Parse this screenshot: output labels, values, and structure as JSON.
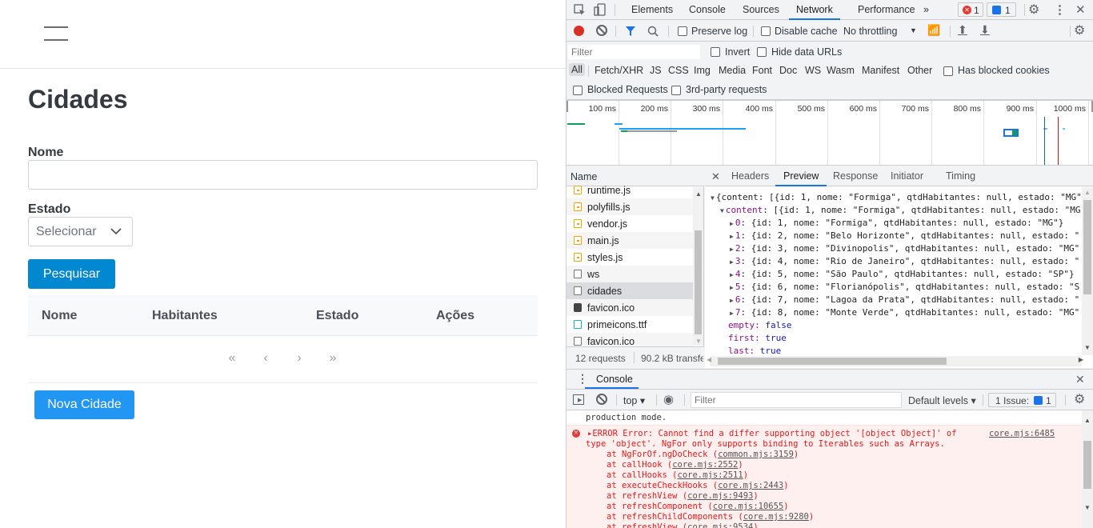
{
  "app": {
    "title": "Cidades",
    "form": {
      "nome_label": "Nome",
      "nome_value": "",
      "estado_label": "Estado",
      "estado_selected": "Selecionar",
      "search_button": "Pesquisar"
    },
    "table": {
      "columns": [
        "Nome",
        "Habitantes",
        "Estado",
        "Ações"
      ],
      "rows": []
    },
    "paginator": {
      "first": "«",
      "prev": "‹",
      "next": "›",
      "last": "»"
    },
    "new_button": "Nova Cidade"
  },
  "devtools": {
    "tabs": [
      "Elements",
      "Console",
      "Sources",
      "Network",
      "Performance",
      "»"
    ],
    "active_tab": "Network",
    "error_count": "1",
    "message_count": "1",
    "network_toolbar": {
      "preserve_log": "Preserve log",
      "disable_cache": "Disable cache",
      "throttling": "No throttling"
    },
    "filter": {
      "placeholder": "Filter",
      "invert": "Invert",
      "hide_data_urls": "Hide data URLs",
      "types": [
        "All",
        "Fetch/XHR",
        "JS",
        "CSS",
        "Img",
        "Media",
        "Font",
        "Doc",
        "WS",
        "Wasm",
        "Manifest",
        "Other"
      ],
      "has_blocked_cookies": "Has blocked cookies",
      "blocked_requests": "Blocked Requests",
      "third_party": "3rd-party requests"
    },
    "timeline": {
      "ticks": [
        "100 ms",
        "200 ms",
        "300 ms",
        "400 ms",
        "500 ms",
        "600 ms",
        "700 ms",
        "800 ms",
        "900 ms",
        "1000 ms"
      ]
    },
    "requests": {
      "header": "Name",
      "items": [
        {
          "name": "runtime.js",
          "type": "js"
        },
        {
          "name": "polyfills.js",
          "type": "js"
        },
        {
          "name": "vendor.js",
          "type": "js"
        },
        {
          "name": "main.js",
          "type": "js"
        },
        {
          "name": "styles.js",
          "type": "js"
        },
        {
          "name": "ws",
          "type": "other"
        },
        {
          "name": "cidades",
          "type": "other",
          "selected": true
        },
        {
          "name": "favicon.ico",
          "type": "img"
        },
        {
          "name": "primeicons.ttf",
          "type": "font"
        },
        {
          "name": "favicon.ico",
          "type": "other"
        }
      ],
      "summary_count": "12 requests",
      "summary_size": "90.2 kB transfe"
    },
    "detail_tabs": [
      "Headers",
      "Preview",
      "Response",
      "Initiator",
      "Timing"
    ],
    "active_detail_tab": "Preview",
    "preview": {
      "root": "{content: [{id: 1, nome: \"Formiga\", qtdHabitantes: null, estado: \"MG\"",
      "content_key": "content",
      "content_summary": ": [{id: 1, nome: \"Formiga\", qtdHabitantes: null, estado: \"MG",
      "items": [
        {
          "index": "0",
          "text": ": {id: 1, nome: \"Formiga\", qtdHabitantes: null, estado: \"MG\"}"
        },
        {
          "index": "1",
          "text": ": {id: 2, nome: \"Belo Horizonte\", qtdHabitantes: null, estado: \""
        },
        {
          "index": "2",
          "text": ": {id: 3, nome: \"Divinopolis\", qtdHabitantes: null, estado: \"MG\""
        },
        {
          "index": "3",
          "text": ": {id: 4, nome: \"Rio de Janeiro\", qtdHabitantes: null, estado: \""
        },
        {
          "index": "4",
          "text": ": {id: 5, nome: \"São Paulo\", qtdHabitantes: null, estado: \"SP\"}"
        },
        {
          "index": "5",
          "text": ": {id: 6, nome: \"Florianópolis\", qtdHabitantes: null, estado: \"S"
        },
        {
          "index": "6",
          "text": ": {id: 7, nome: \"Lagoa da Prata\", qtdHabitantes: null, estado: \""
        },
        {
          "index": "7",
          "text": ": {id: 8, nome: \"Monte Verde\", qtdHabitantes: null, estado: \"MG\""
        }
      ],
      "props": [
        {
          "key": "empty",
          "value": "false"
        },
        {
          "key": "first",
          "value": "true"
        },
        {
          "key": "last",
          "value": "true"
        }
      ]
    },
    "console": {
      "tab": "Console",
      "context": "top ▾",
      "filter_placeholder": "Filter",
      "levels": "Default levels ▾",
      "issues_label": "1 Issue:",
      "issues_count": "1",
      "prev_message": "production mode.",
      "error": {
        "line1": "▸ERROR Error: Cannot find a differ supporting object '[object Object]' of",
        "line2": "type 'object'. NgFor only supports binding to Iterables such as Arrays.",
        "source": "core.mjs:6485",
        "stack": [
          {
            "fn": "at NgForOf.ngDoCheck (",
            "loc": "common.mjs:3159"
          },
          {
            "fn": "at callHook (",
            "loc": "core.mjs:2552"
          },
          {
            "fn": "at callHooks (",
            "loc": "core.mjs:2511"
          },
          {
            "fn": "at executeCheckHooks (",
            "loc": "core.mjs:2443"
          },
          {
            "fn": "at refreshView (",
            "loc": "core.mjs:9493"
          },
          {
            "fn": "at refreshComponent (",
            "loc": "core.mjs:10655"
          },
          {
            "fn": "at refreshChildComponents (",
            "loc": "core.mjs:9280"
          },
          {
            "fn": "at refreshView (",
            "loc": "core.mjs:9534"
          }
        ]
      }
    }
  },
  "colors": {
    "primary_button": "#0288d1",
    "new_button": "#2196f3",
    "devtools_accent": "#1a73e8",
    "error_red": "#e41a1a"
  }
}
